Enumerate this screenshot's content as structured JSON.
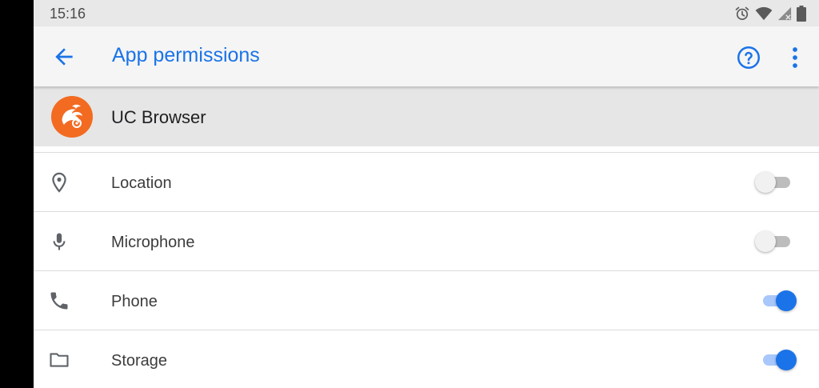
{
  "status_bar": {
    "time": "15:16",
    "icons": [
      "alarm-icon",
      "wifi-icon",
      "signal-icon",
      "battery-icon"
    ]
  },
  "app_bar": {
    "title": "App permissions",
    "back_icon": "arrow-back-icon",
    "help_icon": "help-icon",
    "more_icon": "more-vert-icon",
    "accent_color": "#1a73e8"
  },
  "app": {
    "name": "UC Browser",
    "logo_color": "#f26b21"
  },
  "permissions": [
    {
      "label": "Location",
      "icon": "location-pin-icon",
      "enabled": false
    },
    {
      "label": "Microphone",
      "icon": "microphone-icon",
      "enabled": false
    },
    {
      "label": "Phone",
      "icon": "phone-icon",
      "enabled": true
    },
    {
      "label": "Storage",
      "icon": "folder-icon",
      "enabled": true
    }
  ]
}
